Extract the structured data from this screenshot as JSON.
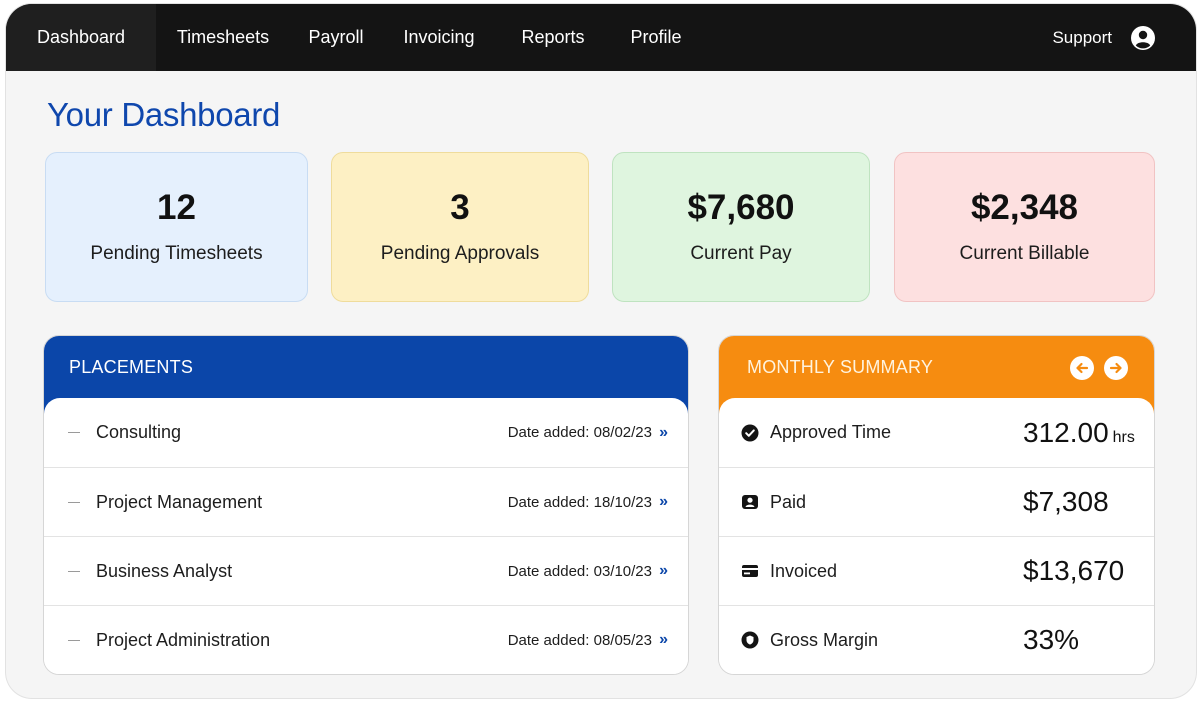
{
  "nav": {
    "items": [
      {
        "label": "Dashboard",
        "active": true
      },
      {
        "label": "Timesheets"
      },
      {
        "label": "Payroll"
      },
      {
        "label": "Invoicing"
      },
      {
        "label": "Reports"
      },
      {
        "label": "Profile"
      }
    ],
    "support_label": "Support",
    "user_icon": "user-circle-icon"
  },
  "page": {
    "title": "Your Dashboard"
  },
  "stats": [
    {
      "value": "12",
      "label": "Pending Timesheets",
      "color": "#e5f0fd"
    },
    {
      "value": "3",
      "label": "Pending Approvals",
      "color": "#fdf0c4"
    },
    {
      "value": "$7,680",
      "label": "Current Pay",
      "color": "#dff5df"
    },
    {
      "value": "$2,348",
      "label": "Current Billable",
      "color": "#fde0e0"
    }
  ],
  "placements": {
    "title": "PLACEMENTS",
    "header_color": "#0b46a9",
    "rows": [
      {
        "label": "Consulting",
        "date": "Date added: 08/02/23",
        "chevron": "»"
      },
      {
        "label": "Project Management",
        "date": "Date added: 18/10/23",
        "chevron": "»"
      },
      {
        "label": "Business Analyst",
        "date": "Date added: 03/10/23",
        "chevron": "»"
      },
      {
        "label": "Project Administration",
        "date": "Date added: 08/05/23",
        "chevron": "»"
      }
    ]
  },
  "summary": {
    "title": "MONTHLY SUMMARY",
    "header_color": "#f68c10",
    "prev_icon": "arrow-left-circle-icon",
    "next_icon": "arrow-right-circle-icon",
    "rows": [
      {
        "icon": "check-circle-icon",
        "label": "Approved Time",
        "value": "312.00",
        "unit": "hrs"
      },
      {
        "icon": "wallet-person-icon",
        "label": "Paid",
        "value": "$7,308",
        "unit": ""
      },
      {
        "icon": "card-icon",
        "label": "Invoiced",
        "value": "$13,670",
        "unit": ""
      },
      {
        "icon": "shield-badge-icon",
        "label": "Gross Margin",
        "value": "33%",
        "unit": ""
      }
    ]
  }
}
